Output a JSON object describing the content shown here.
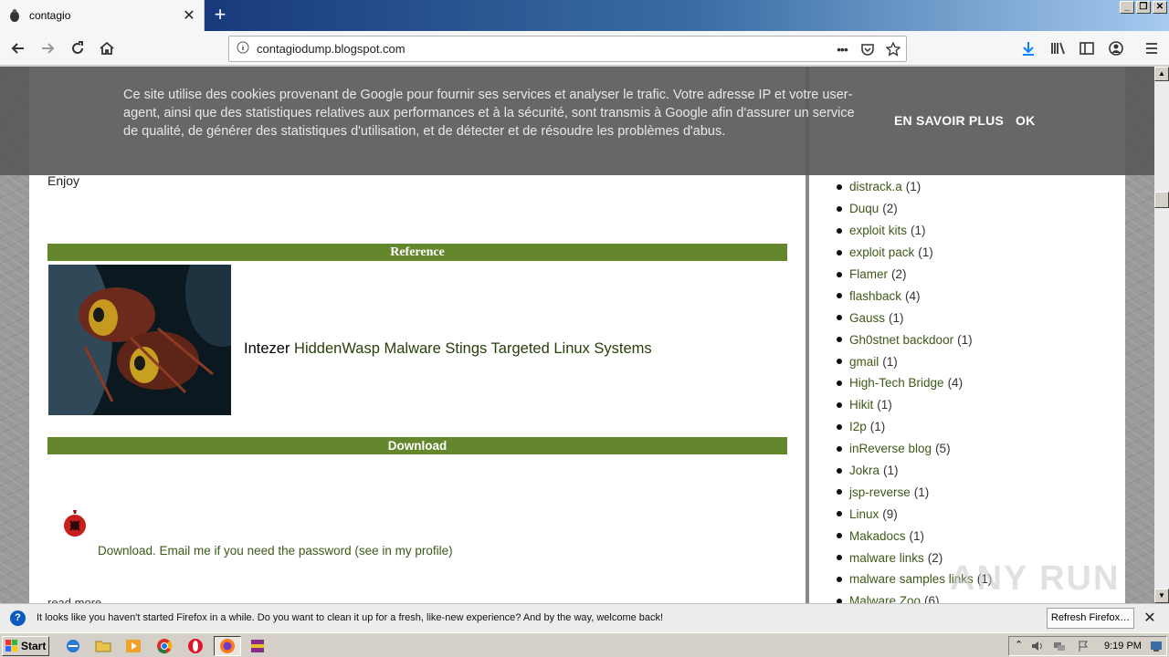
{
  "browser": {
    "tab_title": "contagio",
    "url": "contagiodump.blogspot.com",
    "page_actions_label": "•••"
  },
  "cookie_banner": {
    "text": "Ce site utilise des cookies provenant de Google pour fournir ses services et analyser le trafic. Votre adresse IP et votre user-agent, ainsi que des statistiques relatives aux performances et à la sécurité, sont transmis à Google afin d'assurer un service de qualité, de générer des statistiques d'utilisation, et de détecter et de résoudre les problèmes d'abus.",
    "learn_more": "EN SAVOIR PLUS",
    "ok": "OK"
  },
  "post": {
    "enjoy": "Enjoy",
    "reference_header": "Reference",
    "article_source": "Intezer",
    "article_link": "HiddenWasp Malware Stings Targeted Linux Systems",
    "download_header": "Download",
    "download_text": "Download. Email me if you need the password (see in my profile)",
    "read_more": "read more"
  },
  "sidebar": {
    "labels": [
      {
        "name": "distrack.a",
        "count": "(1)"
      },
      {
        "name": "Duqu",
        "count": "(2)"
      },
      {
        "name": "exploit kits",
        "count": "(1)"
      },
      {
        "name": "exploit pack",
        "count": "(1)"
      },
      {
        "name": "Flamer",
        "count": "(2)"
      },
      {
        "name": "flashback",
        "count": "(4)"
      },
      {
        "name": "Gauss",
        "count": "(1)"
      },
      {
        "name": "Gh0stnet backdoor",
        "count": "(1)"
      },
      {
        "name": "gmail",
        "count": "(1)"
      },
      {
        "name": "High-Tech Bridge",
        "count": "(4)"
      },
      {
        "name": "Hikit",
        "count": "(1)"
      },
      {
        "name": "I2p",
        "count": "(1)"
      },
      {
        "name": "inReverse blog",
        "count": "(5)"
      },
      {
        "name": "Jokra",
        "count": "(1)"
      },
      {
        "name": "jsp-reverse",
        "count": "(1)"
      },
      {
        "name": "Linux",
        "count": "(9)"
      },
      {
        "name": "Makadocs",
        "count": "(1)"
      },
      {
        "name": "malware links",
        "count": "(2)"
      },
      {
        "name": "malware samples links",
        "count": "(1)"
      },
      {
        "name": "Malware Zoo",
        "count": "(6)"
      }
    ]
  },
  "watermark": "ANY RUN",
  "notification": {
    "text": "It looks like you haven't started Firefox in a while. Do you want to clean it up for a fresh, like-new experience? And by the way, welcome back!",
    "button": "Refresh Firefox…"
  },
  "taskbar": {
    "start": "Start",
    "time": "9:19 PM"
  },
  "colors": {
    "accent_green": "#64862c",
    "link_green": "#3a5a18",
    "firefox_download_blue": "#0a84ff"
  }
}
